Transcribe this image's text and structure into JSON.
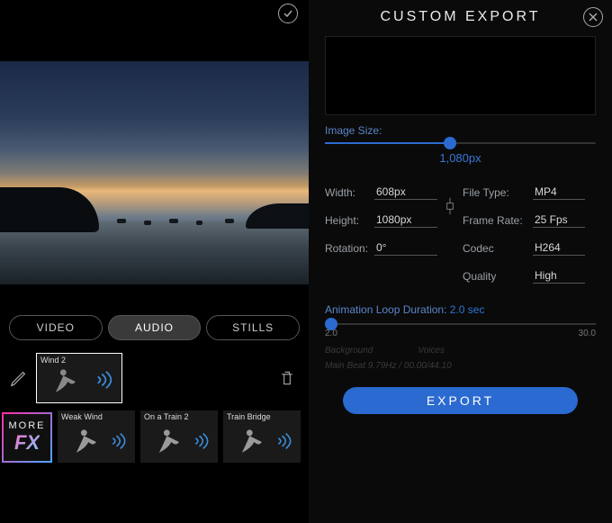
{
  "left": {
    "modes": {
      "video": "VIDEO",
      "audio": "AUDIO",
      "stills": "STILLS",
      "active": "audio"
    },
    "selected_clip": "Wind 2",
    "morefx": {
      "line1": "MORE",
      "line2": "FX"
    },
    "clips": [
      {
        "label": "Weak Wind"
      },
      {
        "label": "On a Train 2"
      },
      {
        "label": "Train Bridge"
      }
    ]
  },
  "right": {
    "title": "CUSTOM  EXPORT",
    "image_size_label": "Image Size:",
    "image_size_value": "1,080px",
    "image_size_pct": 44,
    "width_label": "Width:",
    "width_value": "608px",
    "height_label": "Height:",
    "height_value": "1080px",
    "rotation_label": "Rotation:",
    "rotation_value": "0°",
    "filetype_label": "File Type:",
    "filetype_value": "MP4",
    "framerate_label": "Frame Rate:",
    "framerate_value": "25 Fps",
    "codec_label": "Codec",
    "codec_value": "H264",
    "quality_label": "Quality",
    "quality_value": "High",
    "loop_label": "Animation Loop Duration:",
    "loop_value": "2.0 sec",
    "loop_min": "2.0",
    "loop_max": "30.0",
    "faded1_left": "Background",
    "faded1_right": "Voices",
    "faded2": "Main Beat 9.79Hz / 00.00/44.10",
    "export_button": "EXPORT"
  }
}
